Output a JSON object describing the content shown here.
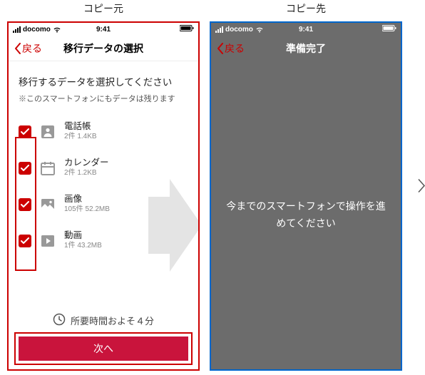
{
  "labels": {
    "source": "コピー元",
    "dest": "コピー先"
  },
  "status": {
    "carrier": "docomo",
    "time": "9:41"
  },
  "source": {
    "back": "戻る",
    "title": "移行データの選択",
    "prompt_main": "移行するデータを選択してください",
    "prompt_sub": "※このスマートフォンにもデータは残ります",
    "items": [
      {
        "name": "電話帳",
        "meta": "2件 1.4KB"
      },
      {
        "name": "カレンダー",
        "meta": "2件 1.2KB"
      },
      {
        "name": "画像",
        "meta": "105件 52.2MB"
      },
      {
        "name": "動画",
        "meta": "1件 43.2MB"
      }
    ],
    "eta": "所要時間およそ４分",
    "next": "次へ"
  },
  "dest": {
    "back": "戻る",
    "title": "準備完了",
    "message": "今までのスマートフォンで操作を進めてください"
  }
}
